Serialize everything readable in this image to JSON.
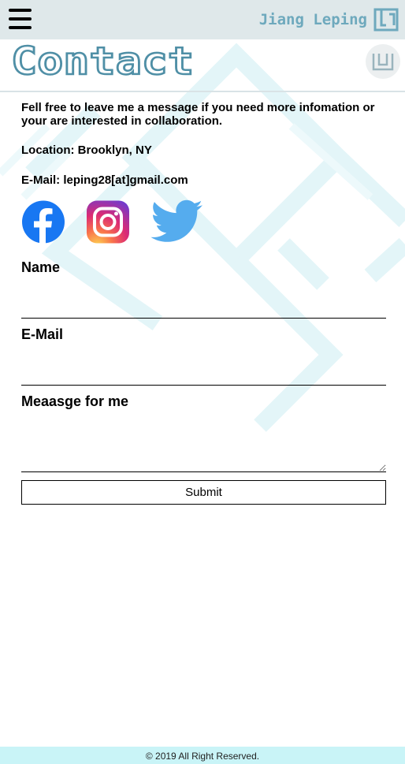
{
  "header": {
    "brand": "Jiang Leping",
    "page_title": "Contact"
  },
  "intro": "Fell free to leave me a message if you need more infomation or your are interested in collaboration.",
  "location": "Location: Brooklyn, NY",
  "email": "E-Mail: leping28[at]gmail.com",
  "social": [
    {
      "name": "facebook-icon",
      "color": "#1877f2"
    },
    {
      "name": "instagram-icon",
      "color": "#e1306c"
    },
    {
      "name": "twitter-icon",
      "color": "#55acee"
    }
  ],
  "form": {
    "name_label": "Name",
    "email_label": "E-Mail",
    "message_label": "Meaasge for me",
    "submit_label": "Submit"
  },
  "footer": "© 2019 All Right Reserved.",
  "colors": {
    "topbar": "#dfe8ea",
    "accent": "#4f8fa6",
    "footer": "#c9f4f7",
    "pattern": "#dff4f7"
  }
}
